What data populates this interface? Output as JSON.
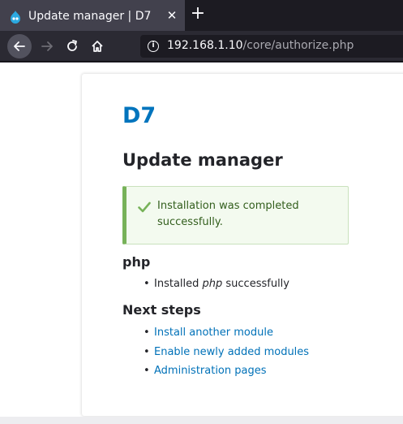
{
  "browser": {
    "tab_title": "Update manager | D7",
    "tab_close": "✕",
    "new_tab": "+",
    "url_host": "192.168.1.10",
    "url_path": "/core/authorize.php",
    "info_symbol": "i"
  },
  "page": {
    "site_name": "D7",
    "title": "Update manager",
    "status": {
      "text": "Installation was completed successfully.",
      "type": "success",
      "icon": "check-icon"
    },
    "project_heading": "php",
    "result": {
      "before": "Installed ",
      "project": "php",
      "after": " successfully"
    },
    "next_steps_heading": "Next steps",
    "next_steps": [
      "Install another module",
      "Enable newly added modules",
      "Administration pages"
    ]
  },
  "colors": {
    "brand_blue": "#0074bd",
    "link": "#0071b8",
    "success_border": "#77b259",
    "success_bg": "#f3faef"
  }
}
